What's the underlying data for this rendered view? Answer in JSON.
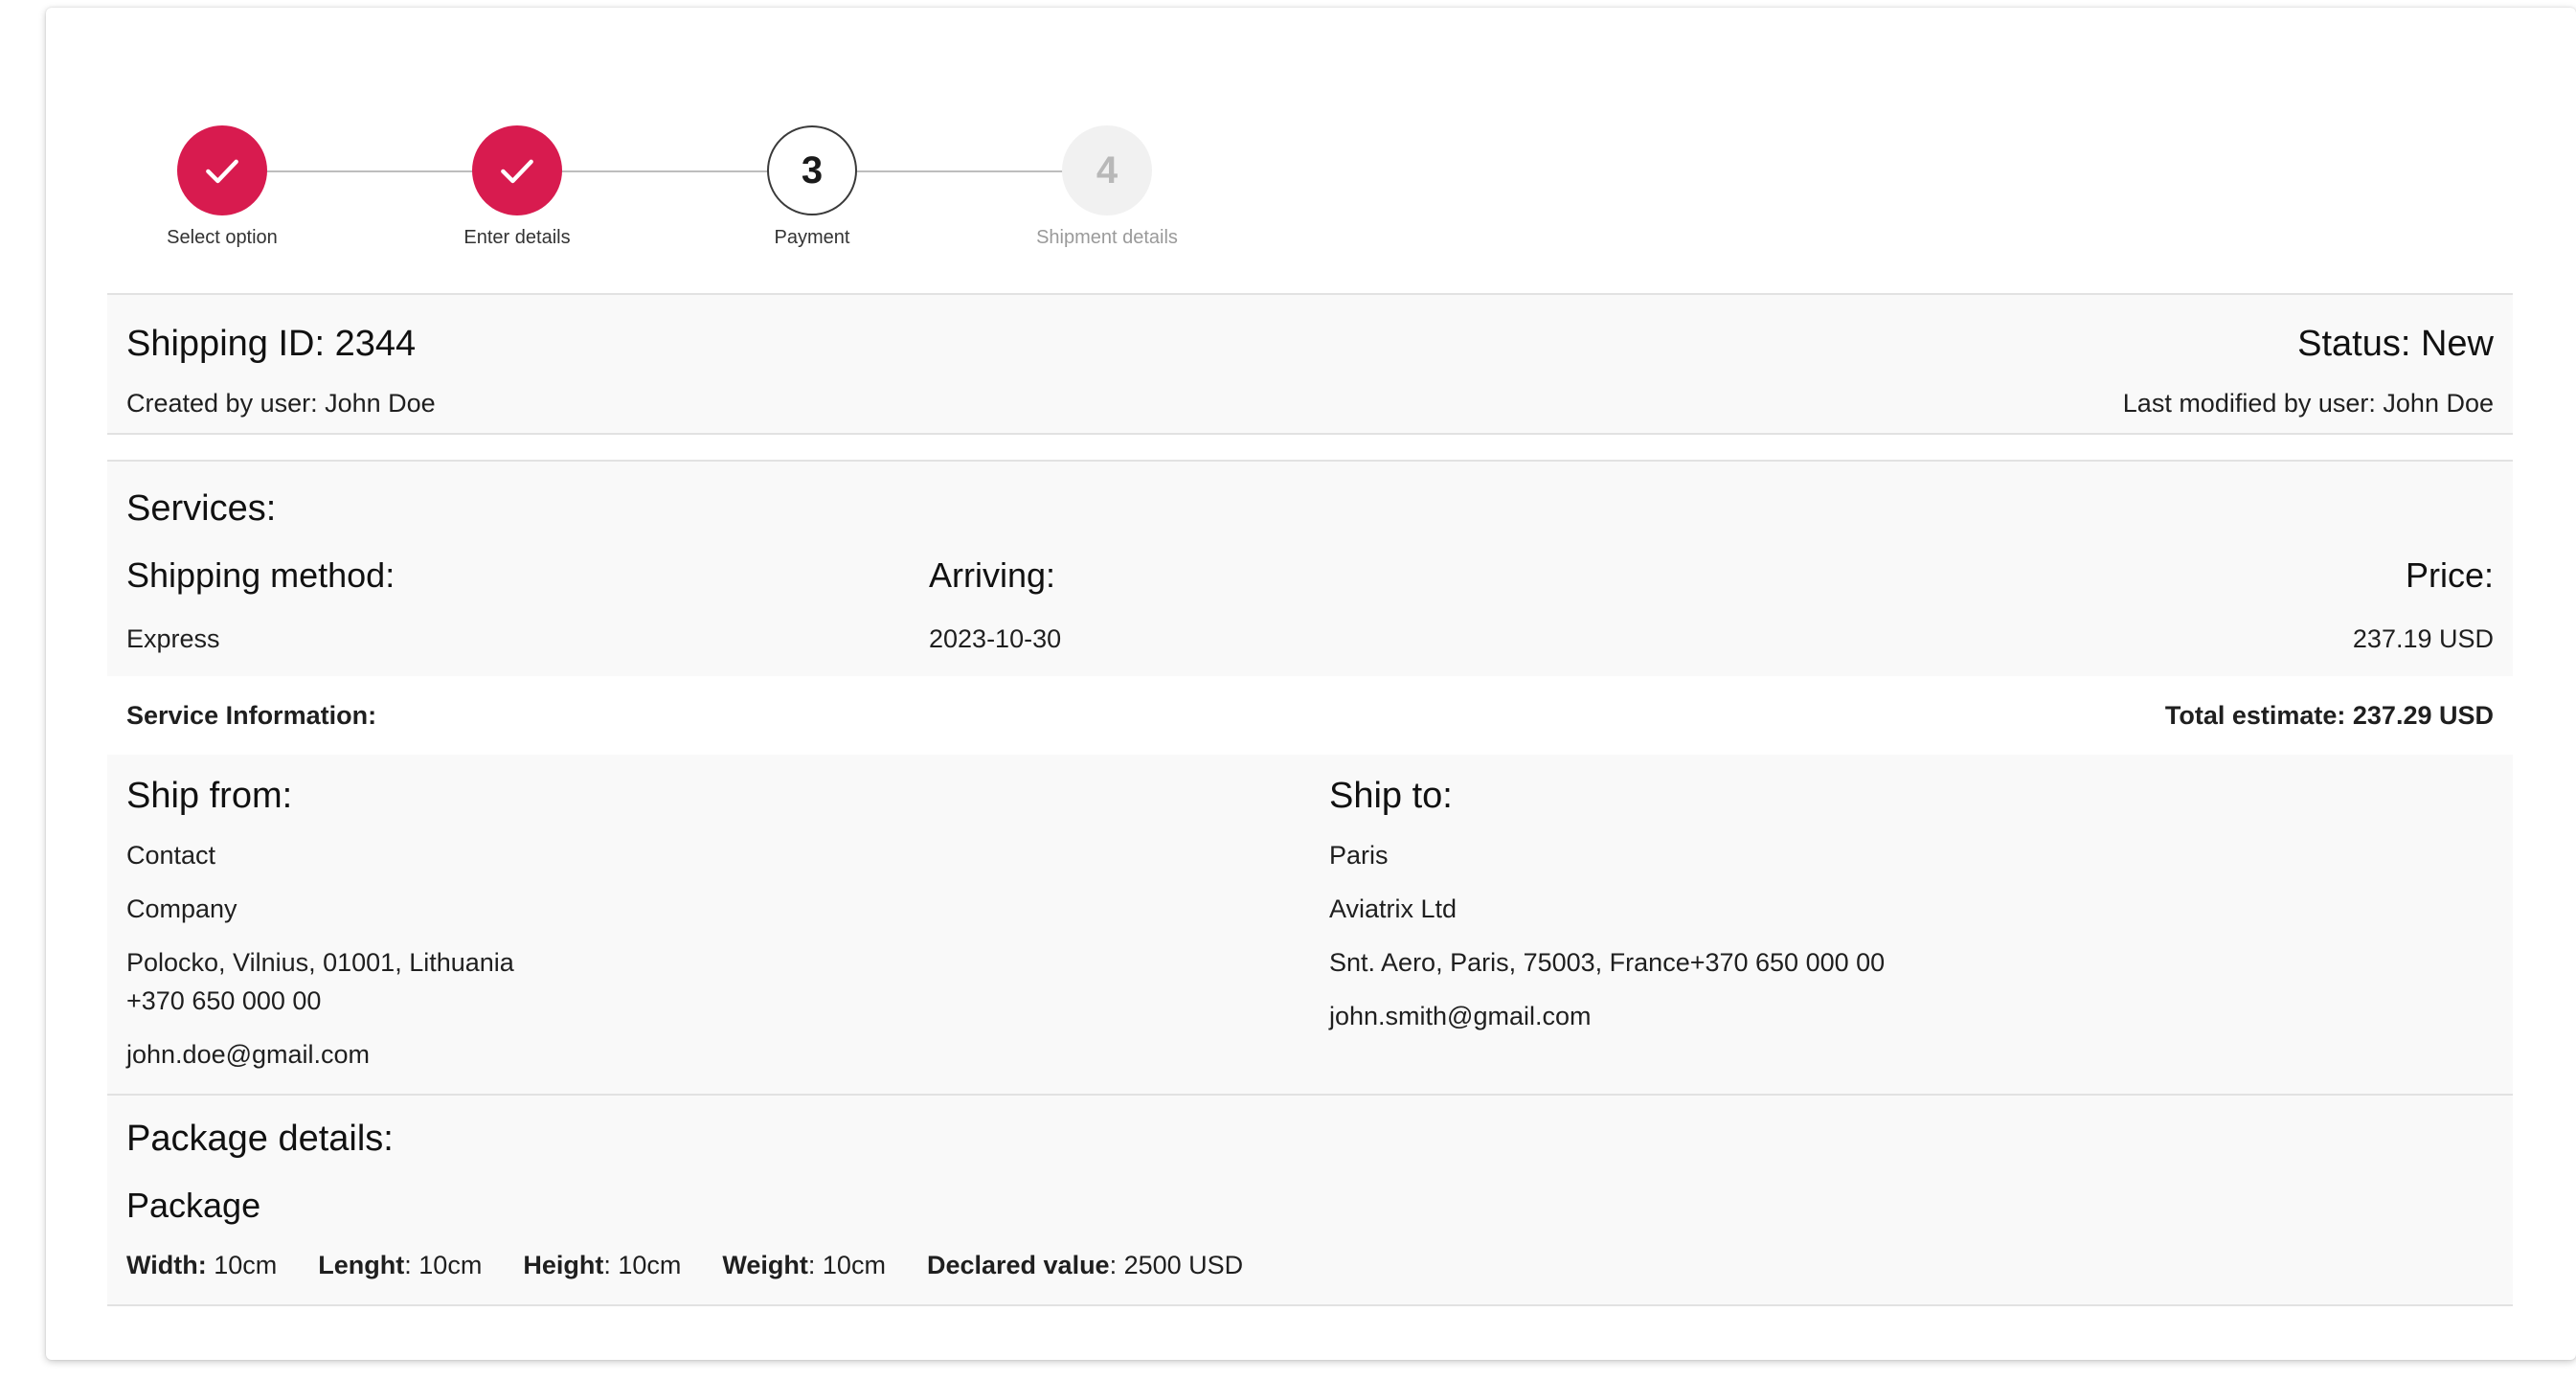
{
  "stepper": {
    "steps": [
      {
        "label": "Select option",
        "state": "done"
      },
      {
        "label": "Enter details",
        "state": "done"
      },
      {
        "label": "Payment",
        "number": "3",
        "state": "active"
      },
      {
        "label": "Shipment details",
        "number": "4",
        "state": "pending"
      }
    ]
  },
  "shipping": {
    "id_text": "Shipping ID: 2344",
    "status_text": "Status: New",
    "created_by": "Created by user: John Doe",
    "modified_by": "Last modified by user: John Doe"
  },
  "services": {
    "title": "Services:",
    "method_label": "Shipping method:",
    "method_value": "Express",
    "arriving_label": "Arriving:",
    "arriving_value": "2023-10-30",
    "price_label": "Price:",
    "price_value": "237.19 USD",
    "info_label": "Service Information:",
    "total_estimate": "Total estimate: 237.29 USD"
  },
  "ship_from": {
    "title": "Ship from:",
    "contact": "Contact",
    "company": "Company",
    "address": "Polocko, Vilnius, 01001, Lithuania",
    "phone": "+370 650 000 00",
    "email": "john.doe@gmail.com"
  },
  "ship_to": {
    "title": "Ship to:",
    "contact": "Paris",
    "company": "Aviatrix Ltd",
    "address_phone": "Snt. Aero, Paris, 75003, France+370 650 000 00",
    "email": "john.smith@gmail.com"
  },
  "package": {
    "title": "Package details:",
    "name": "Package",
    "width_label": "Width:",
    "width_value": "10cm",
    "length_label": "Lenght",
    "length_value": ": 10cm",
    "height_label": "Height",
    "height_value": ": 10cm",
    "weight_label": "Weight",
    "weight_value": ": 10cm",
    "declared_label": "Declared value",
    "declared_value": ": 2500 USD"
  },
  "colors": {
    "accent": "#d81b4f",
    "section_bg": "#f9f9f9",
    "divider": "#e2e2e2"
  }
}
